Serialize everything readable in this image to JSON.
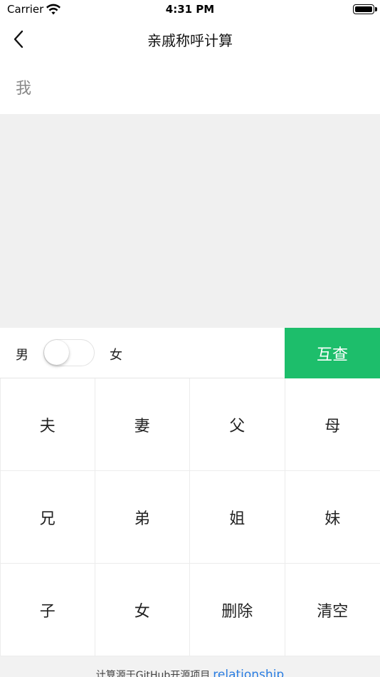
{
  "status_bar": {
    "carrier": "Carrier",
    "time": "4:31 PM"
  },
  "nav": {
    "title": "亲戚称呼计算",
    "back_icon": "chevron-left-icon"
  },
  "query": {
    "text": "我"
  },
  "result": {
    "text": ""
  },
  "gender": {
    "male_label": "男",
    "female_label": "女",
    "toggle_on": false
  },
  "mutual_button": {
    "label": "互查",
    "color": "#1dbe6b"
  },
  "keypad": {
    "keys": [
      "夫",
      "妻",
      "父",
      "母",
      "兄",
      "弟",
      "姐",
      "妹",
      "子",
      "女",
      "删除",
      "清空"
    ]
  },
  "footer": {
    "text": "计算源于GitHub开源项目",
    "link": "relationship",
    "link_color": "#2a7de1"
  }
}
